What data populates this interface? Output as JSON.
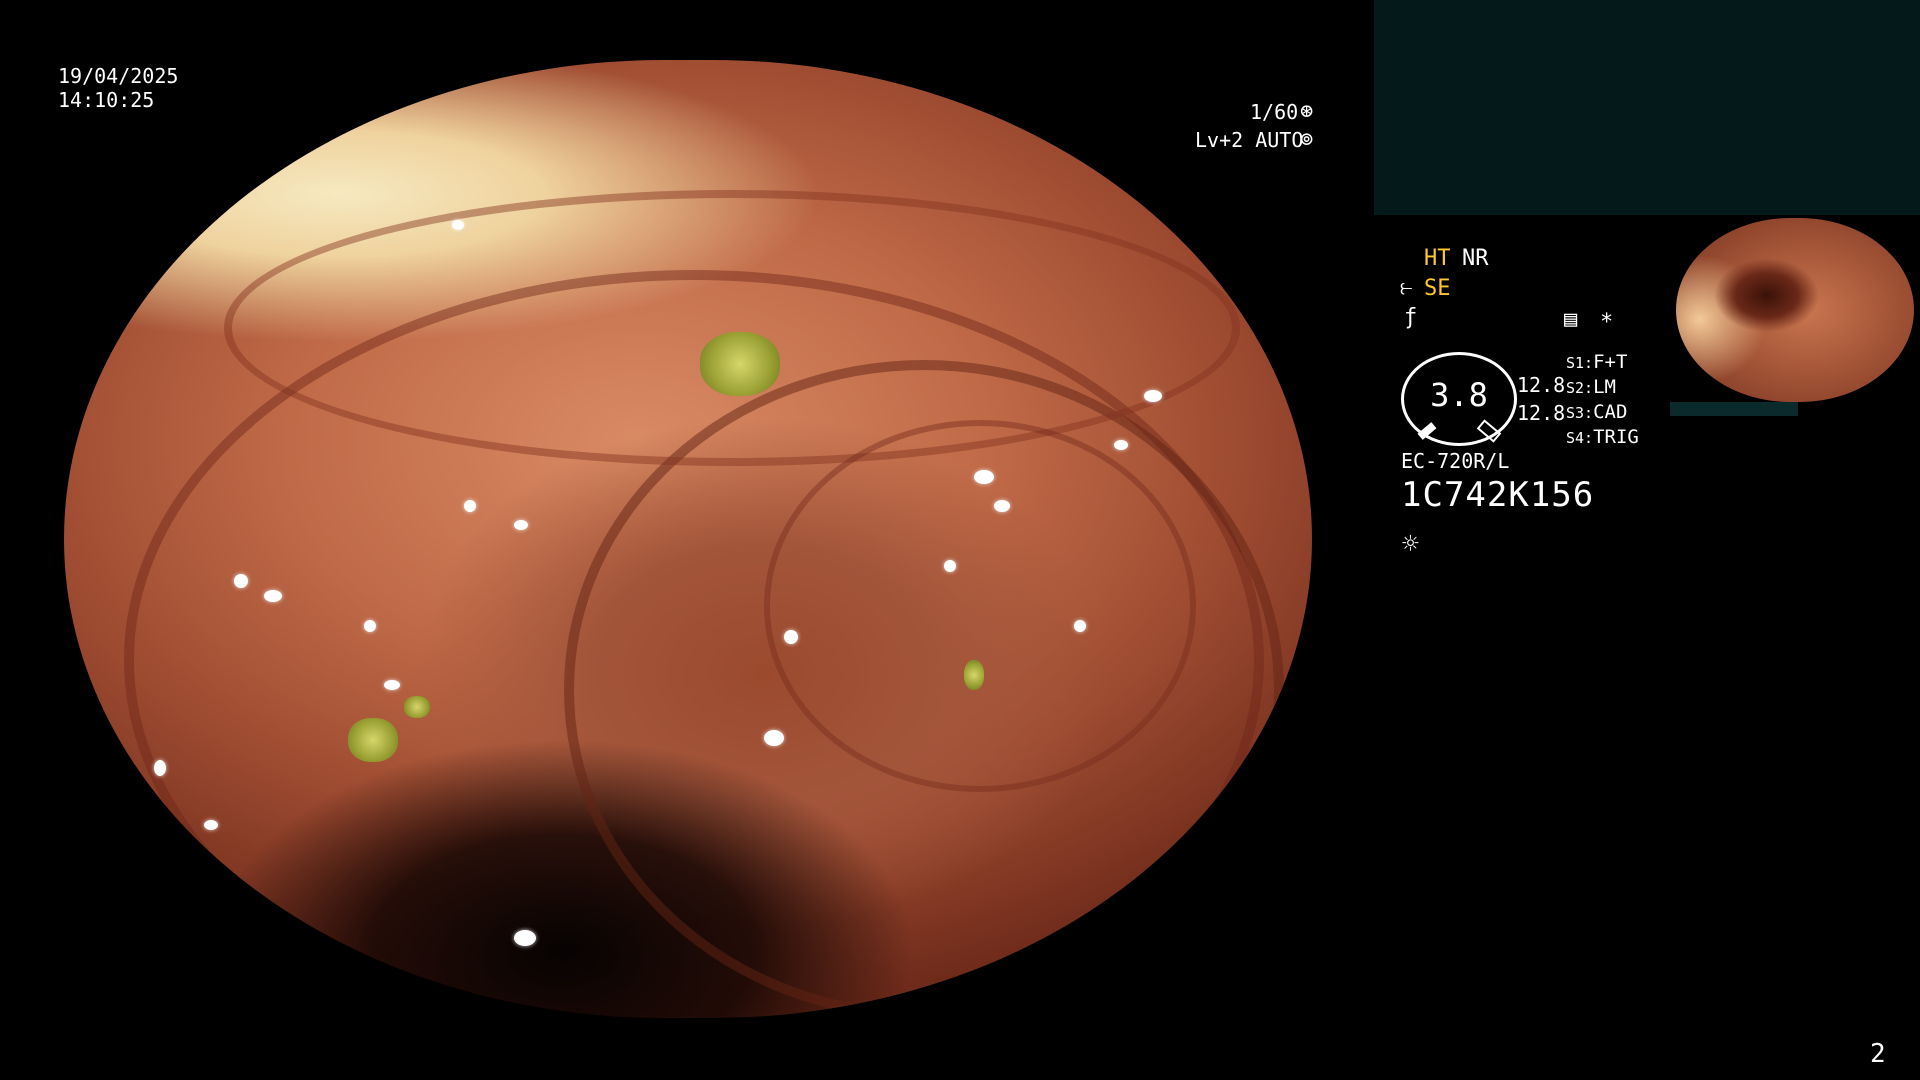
{
  "datetime": {
    "date": "19/04/2025",
    "time": "14:10:25"
  },
  "exposure": {
    "shutter": "1/60",
    "level": "Lv+2 AUTO"
  },
  "panel": {
    "mode_a": "HT",
    "mode_b": "NR",
    "mode_c": "SE",
    "gauge_value": "3.8",
    "readout_1": "12.8",
    "readout_2": "12.8",
    "switches": [
      {
        "key": "S1:",
        "value": "F+T"
      },
      {
        "key": "S2:",
        "value": "LM"
      },
      {
        "key": "S3:",
        "value": "CAD"
      },
      {
        "key": "S4:",
        "value": "TRIG"
      }
    ],
    "asterisk": "*",
    "scope_model": "EC-720R/L",
    "serial": "1C742K156"
  },
  "page_number": "2",
  "icons": {
    "shutter": "aperture-icon",
    "auto": "auto-gear-icon",
    "structure": "structure-enhance-icon",
    "freeze": "freeze-icon",
    "record": "record-icon",
    "light": "light-source-icon"
  },
  "colors": {
    "accent_yellow": "#ffc830",
    "panel_teal": "#03191a"
  }
}
